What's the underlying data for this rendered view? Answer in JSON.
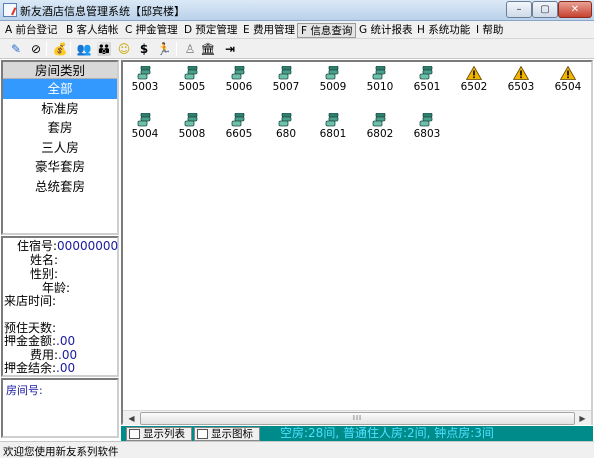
{
  "window": {
    "title": "新友酒店信息管理系统【邸宾楼】",
    "min_label": "–",
    "max_label": "▢",
    "close_label": "✕"
  },
  "menu": [
    {
      "label": "A 前台登记"
    },
    {
      "label": "B 客人结帐"
    },
    {
      "label": "C 押金管理"
    },
    {
      "label": "D 预定管理"
    },
    {
      "label": "E 费用管理"
    },
    {
      "label": "F 信息查询",
      "active": true
    },
    {
      "label": "G 统计报表"
    },
    {
      "label": "H 系统功能"
    },
    {
      "label": "I 帮助"
    }
  ],
  "toolbar": {
    "icons": [
      "edit-icon",
      "clock-icon",
      "money-bag-icon",
      "people-icon",
      "group-icon",
      "smiley-icon",
      "dollar-icon",
      "runner-icon",
      "stand-icon",
      "bank-icon",
      "exit-icon"
    ],
    "glyphs": [
      "✎",
      "⊘",
      "💰",
      "👥",
      "👪",
      "☺",
      "$",
      "🏃",
      "♙",
      "🏛",
      "⇥"
    ]
  },
  "room_types": {
    "header": "房间类别",
    "items": [
      "全部",
      "标准房",
      "套房",
      "三人房",
      "豪华套房",
      "总统套房"
    ],
    "selected_index": 0
  },
  "guest_info": {
    "room_no_label": "住宿号:",
    "room_no_value": "00000000",
    "name_label": "姓名:",
    "gender_label": "性别:",
    "age_label": "年龄:",
    "arrival_label": "来店时间:",
    "days_label": "预住天数:",
    "deposit_label": "押金金额:",
    "deposit_value": ".00",
    "fee_label": "费用:",
    "fee_value": ".00",
    "balance_label": "押金结余:",
    "balance_value": ".00"
  },
  "room_number_label": "房间号:",
  "rooms_row1": [
    {
      "number": "5003",
      "status": "vacant"
    },
    {
      "number": "5005",
      "status": "vacant"
    },
    {
      "number": "5006",
      "status": "vacant"
    },
    {
      "number": "5007",
      "status": "vacant"
    },
    {
      "number": "5009",
      "status": "vacant"
    },
    {
      "number": "5010",
      "status": "vacant"
    },
    {
      "number": "6501",
      "status": "vacant"
    },
    {
      "number": "6502",
      "status": "maintenance"
    },
    {
      "number": "6503",
      "status": "maintenance"
    },
    {
      "number": "6504",
      "status": "maintenance"
    }
  ],
  "rooms_row2": [
    {
      "number": "5004",
      "status": "vacant"
    },
    {
      "number": "5008",
      "status": "vacant"
    },
    {
      "number": "6605",
      "status": "vacant"
    },
    {
      "number": "680",
      "status": "vacant"
    },
    {
      "number": "6801",
      "status": "vacant"
    },
    {
      "number": "6802",
      "status": "vacant"
    },
    {
      "number": "6803",
      "status": "vacant"
    }
  ],
  "scrollbar": {
    "left_arrow": "◀",
    "right_arrow": "▶",
    "grip": "III"
  },
  "view_buttons": {
    "list_label": "显示列表",
    "icon_label": "显示图标"
  },
  "summary": "空房:28间, 普通住人房:2间, 钟点房:3间",
  "status_bar": "欢迎您使用新友系列软件",
  "colors": {
    "selected_bg": "#3399ff",
    "bottom_bar_bg": "#008b8b",
    "summary_text": "#4fe0ff",
    "value_text": "#1a1aa0",
    "warning": "#f2b400"
  }
}
